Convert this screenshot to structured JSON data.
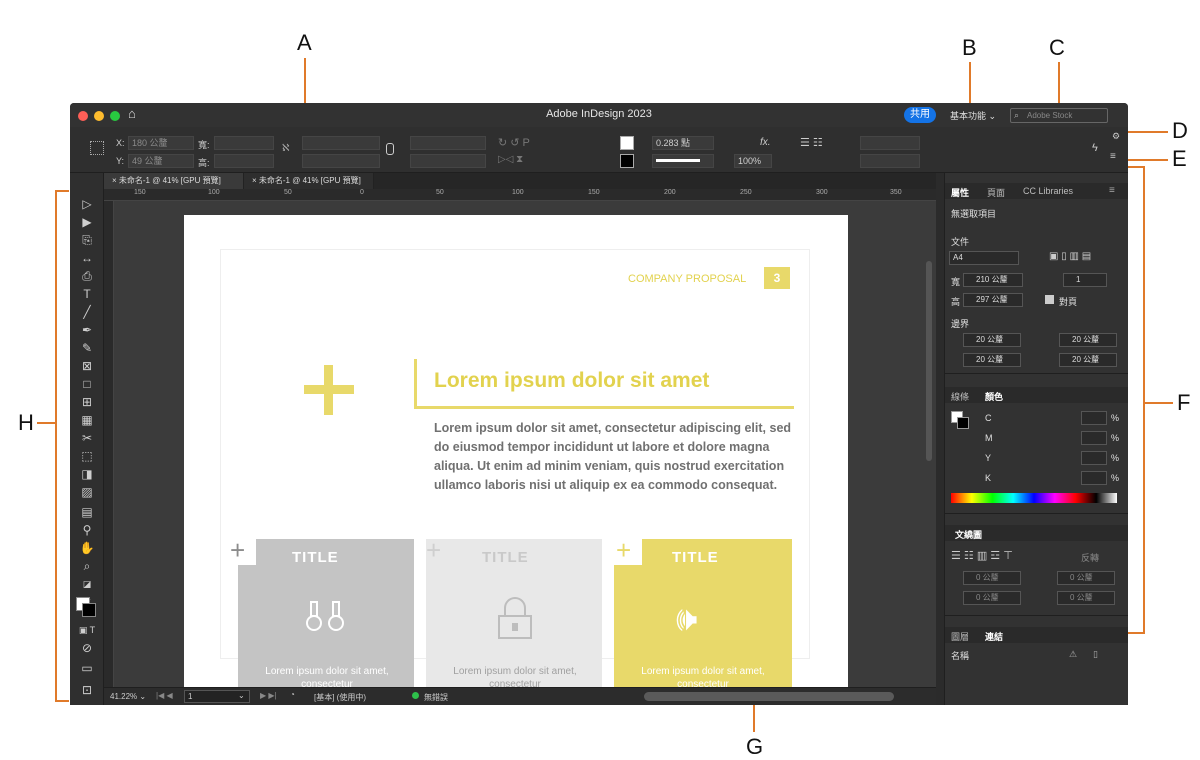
{
  "callouts": [
    "A",
    "B",
    "C",
    "D",
    "E",
    "F",
    "G",
    "H"
  ],
  "window": {
    "title": "Adobe InDesign 2023",
    "share_label": "共用",
    "workspace_label": "基本功能 ⌄",
    "stock_placeholder": "Adobe Stock"
  },
  "controlbar": {
    "x_label": "X:",
    "x_value": "180 公釐",
    "y_label": "Y:",
    "y_value": "49 公釐",
    "w_label": "寬:",
    "h_label": "高:",
    "stroke_value": "0.283 點",
    "zoom_value": "100%"
  },
  "tabs": [
    {
      "label": "× 未命名-1 @ 41% [GPU 預覽]"
    },
    {
      "label": "× 未命名-1 @ 41% [GPU 預覽]"
    }
  ],
  "ruler": [
    "150",
    "100",
    "50",
    "0",
    "50",
    "100",
    "150",
    "200",
    "250",
    "300",
    "350"
  ],
  "document": {
    "header": "COMPANY PROPOSAL",
    "page_number": "3",
    "headline": "Lorem ipsum dolor sit amet",
    "body": "Lorem ipsum dolor sit amet, consectetur adipiscing elit, sed do eiusmod tempor incididunt ut labore et dolore magna aliqua. Ut enim ad minim veniam, quis nostrud exercitation ullamco laboris nisi ut aliquip ex ea commodo consequat.",
    "cards": [
      {
        "title": "TITLE",
        "caption": "Lorem ipsum dolor sit amet, consectetur"
      },
      {
        "title": "TITLE",
        "caption": "Lorem ipsum dolor sit amet, consectetur"
      },
      {
        "title": "TITLE",
        "caption": "Lorem ipsum dolor sit amet, consectetur"
      }
    ]
  },
  "statusbar": {
    "zoom": "41.22% ⌄",
    "page": "1",
    "style": "[基本] (使用中)",
    "errors": "無錯誤"
  },
  "panels": {
    "tabs": [
      "屬性",
      "頁面",
      "CC Libraries"
    ],
    "no_selection": "無選取項目",
    "document_label": "文件",
    "page_size": "A4",
    "width_label": "寬",
    "width_value": "210 公釐",
    "height_label": "高",
    "height_value": "297 公釐",
    "pages_value": "1",
    "facing_label": "對頁",
    "margins_label": "邊界",
    "margin_values": [
      "20 公釐",
      "20 公釐",
      "20 公釐",
      "20 公釐"
    ],
    "color_tabs": [
      "線條",
      "顏色"
    ],
    "cmyk": [
      "C",
      "M",
      "Y",
      "K"
    ],
    "percent": "%",
    "align_label": "文繞圖",
    "invert_label": "反轉",
    "offset_values": [
      "0 公釐",
      "0 公釐",
      "0 公釐",
      "0 公釐"
    ],
    "layer_tabs": [
      "圖層",
      "連結"
    ],
    "name_label": "名稱"
  },
  "colors": {
    "accent_yellow": "#e8d96a",
    "card_gray": "#c4c4c4",
    "card_light": "#e8e8e8",
    "orange_line": "#e07a2a"
  }
}
